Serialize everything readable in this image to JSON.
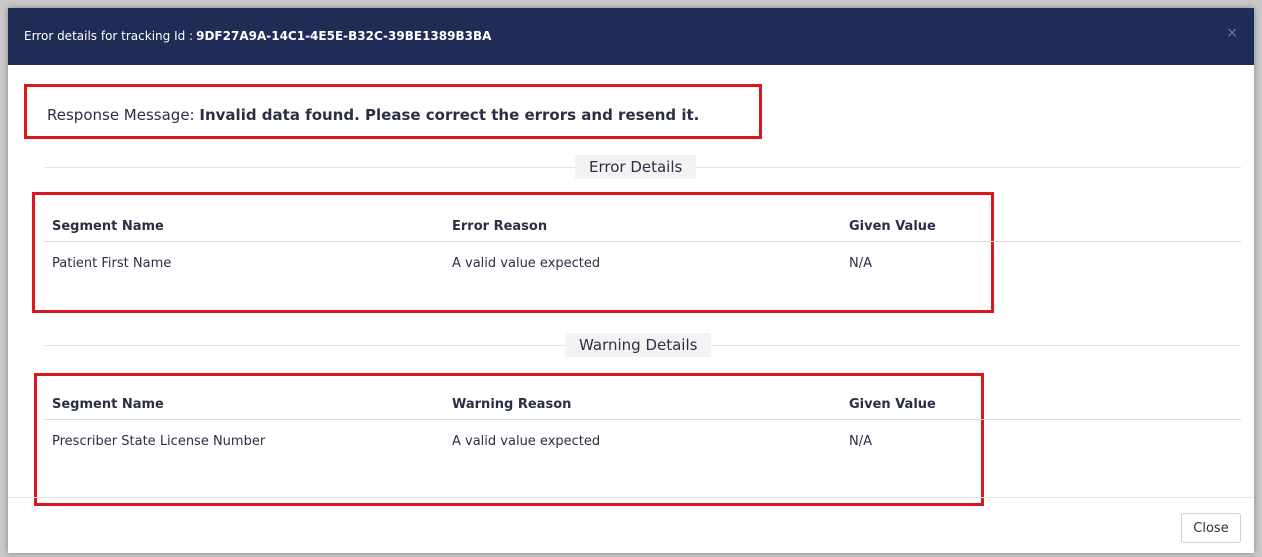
{
  "header": {
    "title_prefix": "Error details for tracking Id :",
    "tracking_id": "9DF27A9A-14C1-4E5E-B32C-39BE1389B3BA",
    "close_icon": "×"
  },
  "response": {
    "label": "Response Message:",
    "message": "Invalid data found. Please correct the errors and resend it."
  },
  "error_details": {
    "title": "Error Details",
    "columns": [
      "Segment Name",
      "Error Reason",
      "Given Value"
    ],
    "rows": [
      [
        "Patient First Name",
        "A valid value expected",
        "N/A"
      ]
    ]
  },
  "warning_details": {
    "title": "Warning Details",
    "columns": [
      "Segment Name",
      "Warning Reason",
      "Given Value"
    ],
    "rows": [
      [
        "Prescriber State License Number",
        "A valid value expected",
        "N/A"
      ]
    ]
  },
  "footer": {
    "close_label": "Close"
  },
  "colors": {
    "header_bg": "#1f2c55",
    "highlight_border": "#d9181e",
    "text": "#2a2f45"
  }
}
